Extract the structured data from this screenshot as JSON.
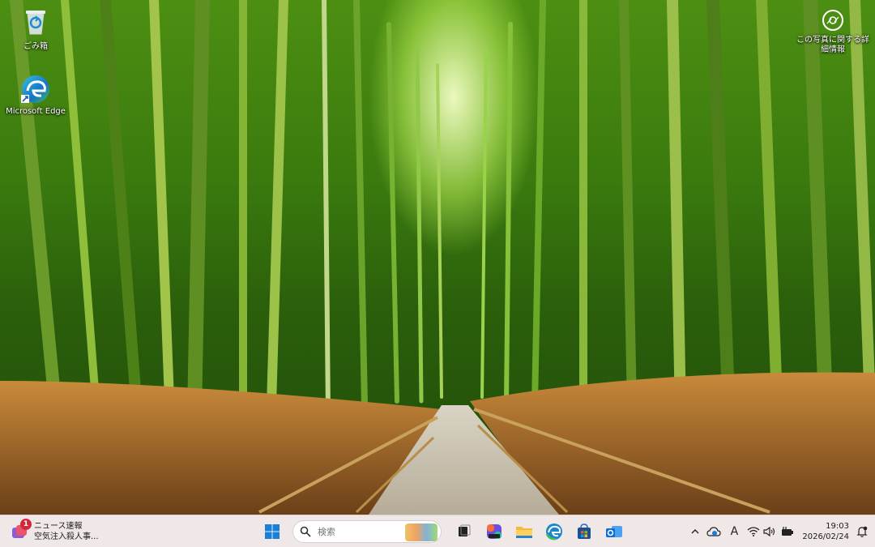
{
  "desktop": {
    "icons": [
      {
        "label": "ごみ箱",
        "icon": "recycle-bin-icon"
      },
      {
        "label": "Microsoft Edge",
        "icon": "edge-icon"
      }
    ],
    "photo_info": {
      "label": "この写真に関する詳細情報",
      "icon": "camera-info-icon"
    }
  },
  "taskbar": {
    "news": {
      "title": "ニュース速報",
      "subtitle": "空気注入殺人事...",
      "badge": "1"
    },
    "search": {
      "placeholder": "検索"
    },
    "pinned": [
      "windows-start-icon",
      "task-view-icon",
      "copilot-icon",
      "file-explorer-icon",
      "edge-icon",
      "store-icon",
      "outlook-icon"
    ],
    "tray": {
      "ime": "A",
      "time": "19:03",
      "date": "2026/02/24"
    }
  },
  "colors": {
    "taskbar_bg": "#efe8e7",
    "accent_blue": "#0a6cd6",
    "badge_red": "#d3283a"
  }
}
